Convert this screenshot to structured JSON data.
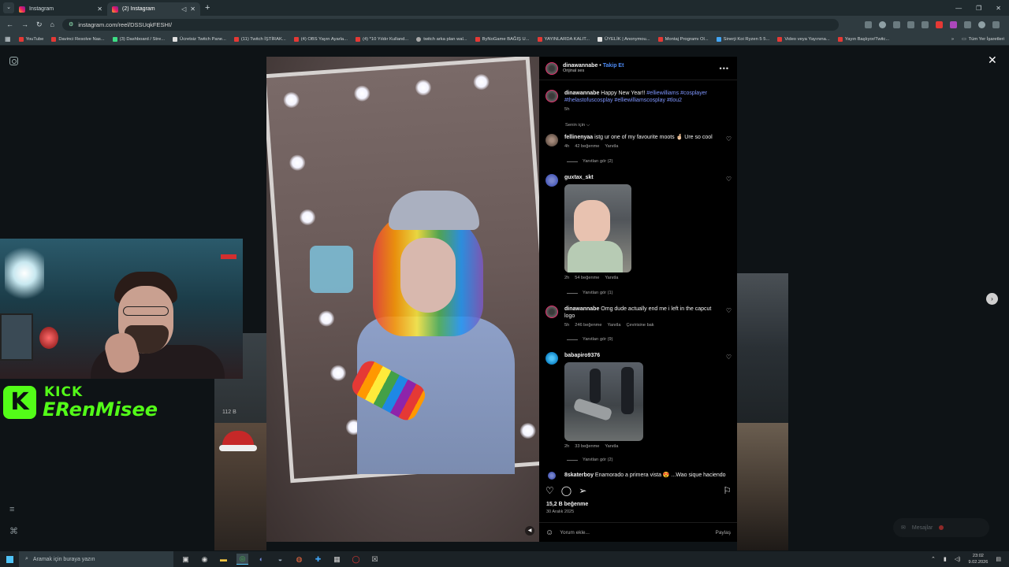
{
  "browser": {
    "tabs": [
      {
        "title": "Instagram",
        "active": false
      },
      {
        "title": "(2) Instagram",
        "active": true
      }
    ],
    "url": "instagram.com/reel/DSSUqkFESHI/",
    "bookmarks": [
      "YouTube",
      "Davinci Resolve Nas...",
      "(3) Dashboard / Stre...",
      "Ücretsiz Twitch Pane...",
      "(11) Twitch İŞTİRAK...",
      "(4) OBS Yayın Ayarla...",
      "(4) *10 Yıldır Kulland...",
      "twitch arka plan wal...",
      "ByNoGame BAĞIŞ U...",
      "YAYINLARDA KALIT...",
      "ÜYELİK | Anonymou...",
      "Montaj Programı Ol...",
      "Sinerji Koi Ryzen 5 5...",
      "Video veya Yayınına...",
      "Yayın Başlıyor/Twitc..."
    ],
    "bookmarks_right": "Tüm Yer İşaretleri"
  },
  "post": {
    "author": "dinawannabe",
    "follow_label": "Takip Et",
    "audio": "Orijinal ses",
    "caption_prefix": "Happy New Year!! ",
    "caption_tags": "#elliewilliams #cosplayer #thelastofuscosplay #elliewilliamscosplay #tlou2",
    "caption_time": "5h",
    "sort_label": "Senin için ⌵",
    "likes": "15,2 B beğenme",
    "date": "30 Aralık 2025",
    "comment_placeholder": "Yorum ekle...",
    "share_label": "Paylaş"
  },
  "comments": [
    {
      "user": "fellinenyaa",
      "text": "istg ur one of my favourite moots 🤞🏻 Ure so cool",
      "time": "4h",
      "likes": "42 beğenme",
      "reply": "Yanıtla",
      "replies": "Yanıtları gör (2)"
    },
    {
      "user": "guxtax_skt",
      "text": "",
      "time": "2h",
      "likes": "54 beğenme",
      "reply": "Yanıtla",
      "replies": "Yanıtları gör (1)"
    },
    {
      "user": "dinawannabe",
      "text": "Omg dude actually end me i left in the capcut logo",
      "time": "5h",
      "likes": "246 beğenme",
      "reply": "Yanıtla",
      "translate": "Çevirisine bak",
      "replies": "Yanıtları gör (9)"
    },
    {
      "user": "babapiro9376",
      "text": "",
      "time": "2h",
      "likes": "33 beğenme",
      "reply": "Yanıtla",
      "replies": "Yanıtları gör (2)"
    },
    {
      "user": "8skaterboy",
      "text": "Enamorado a primera vista 😍 ...Wao sique haciendo"
    }
  ],
  "background": {
    "views": "112 B",
    "messages_label": "Mesajlar"
  },
  "stream": {
    "brand": "KICK",
    "channel": "ERenMisee"
  },
  "taskbar": {
    "search_placeholder": "Aramak için buraya yazın",
    "time": "23:02",
    "date": "9.02.2026"
  }
}
